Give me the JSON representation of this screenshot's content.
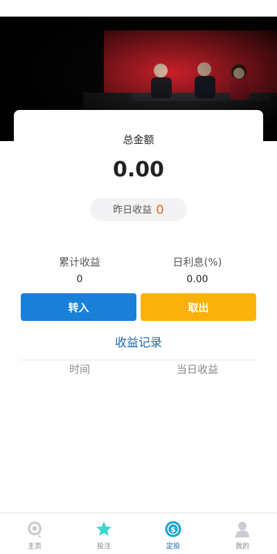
{
  "summary": {
    "total_label": "总金额",
    "total_amount": "0.00",
    "yesterday_label": "昨日收益",
    "yesterday_value": "0"
  },
  "stats": {
    "cumulative_label": "累计收益",
    "cumulative_value": "0",
    "rate_label": "日利息(%)",
    "rate_value": "0.00"
  },
  "actions": {
    "transfer_in": "转入",
    "withdraw": "取出"
  },
  "records": {
    "title": "收益记录",
    "col_time": "时间",
    "col_daily": "当日收益"
  },
  "colors": {
    "primary_blue": "#1a80d8",
    "accent_yellow": "#fbb10b",
    "earnings_orange": "#e86a1e",
    "link_blue": "#1c6aa8"
  },
  "tabbar": {
    "items": [
      {
        "label": "主页",
        "icon": "home-icon"
      },
      {
        "label": "投注",
        "icon": "star-icon"
      },
      {
        "label": "定投",
        "icon": "dollar-circle-icon",
        "active": true
      },
      {
        "label": "我的",
        "icon": "user-icon"
      }
    ]
  }
}
